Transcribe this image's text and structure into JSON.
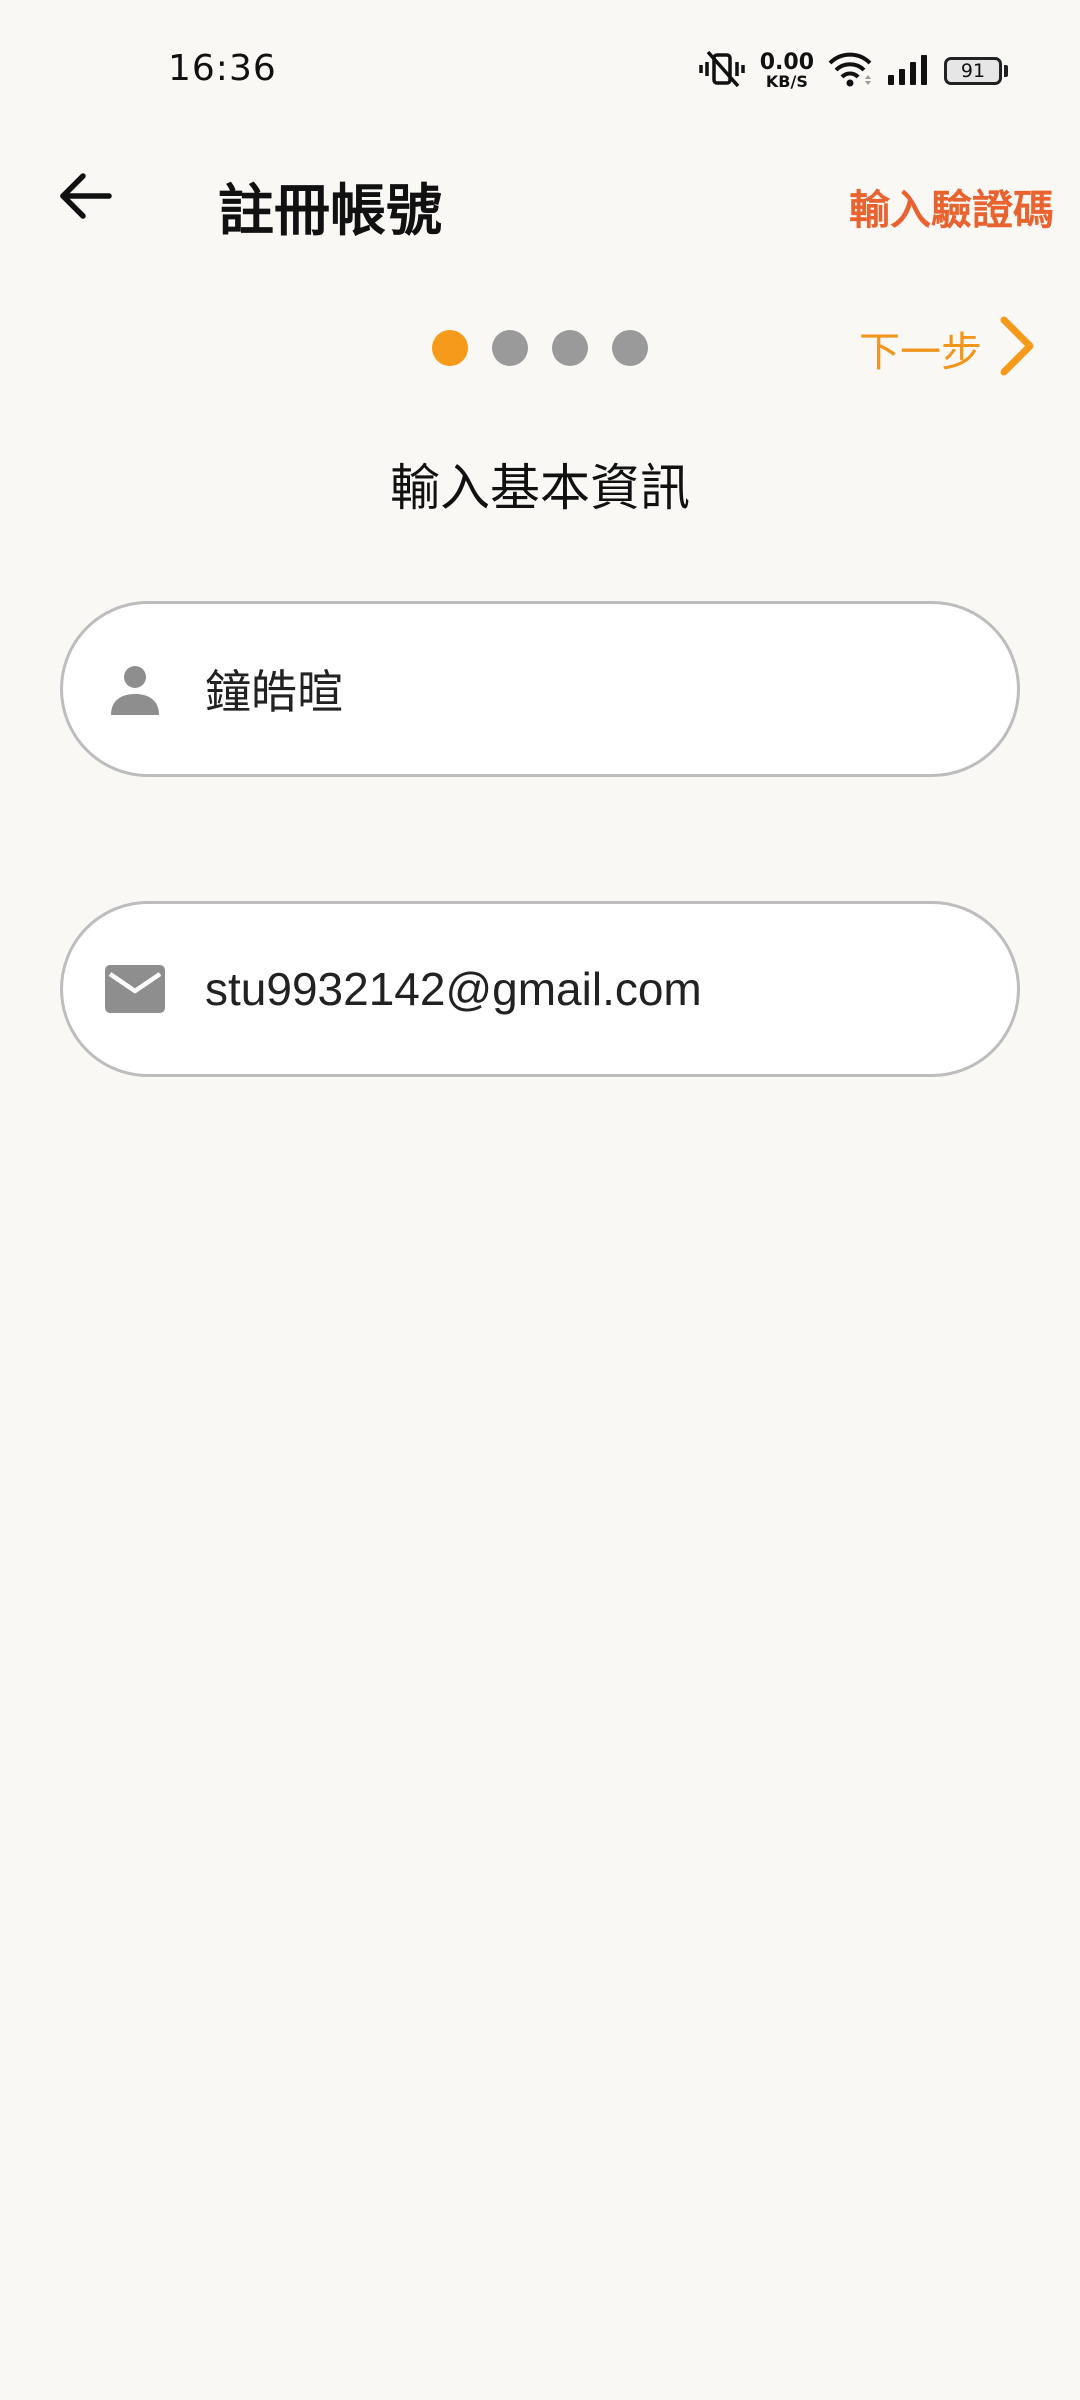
{
  "status_bar": {
    "time": "16:36",
    "net_speed_value": "0.00",
    "net_speed_unit": "KB/S",
    "battery_level": "91"
  },
  "header": {
    "title": "註冊帳號",
    "verify_link": "輸入驗證碼"
  },
  "steps": {
    "total": 4,
    "current": 1,
    "next_label": "下一步"
  },
  "section_title": "輸入基本資訊",
  "form": {
    "name_value": "鐘皓暄",
    "email_value": "stu9932142@gmail.com"
  },
  "colors": {
    "accent_orange": "#f59a1b",
    "link_red_orange": "#e8632f",
    "icon_gray": "#8e8e8e",
    "background": "#f9f8f5"
  }
}
